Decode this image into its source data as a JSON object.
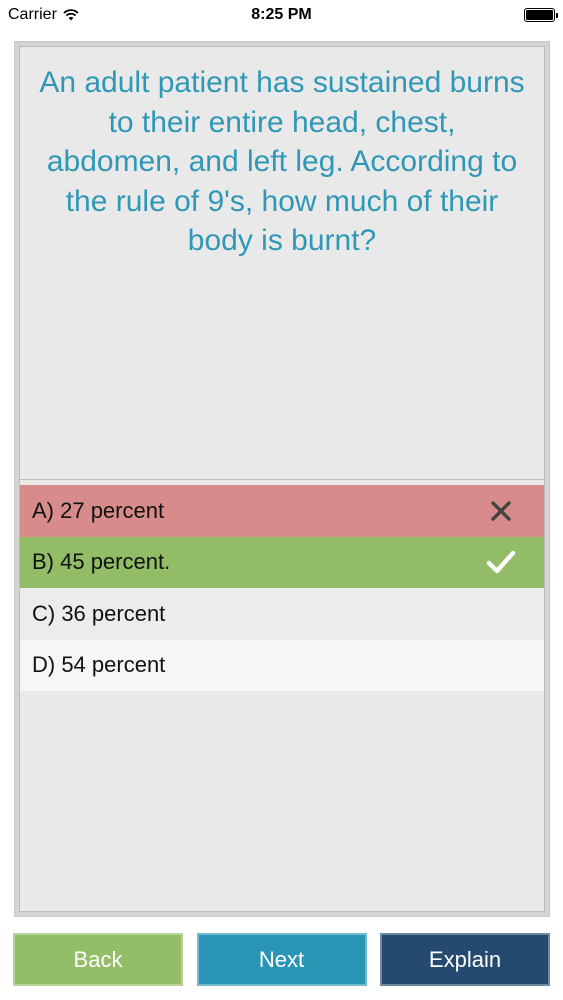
{
  "status_bar": {
    "carrier": "Carrier",
    "time": "8:25 PM"
  },
  "question": {
    "text": "An adult patient has sustained burns to their entire head, chest, abdomen, and left leg. According to the rule of 9's, how much of their body is burnt?"
  },
  "answers": [
    {
      "label": "A) 27 percent",
      "state": "wrong",
      "icon": "x-mark-icon"
    },
    {
      "label": "B) 45 percent.",
      "state": "correct",
      "icon": "check-mark-icon"
    },
    {
      "label": "C) 36 percent",
      "state": "neutral"
    },
    {
      "label": "D) 54 percent",
      "state": "neutral"
    }
  ],
  "buttons": {
    "back": "Back",
    "next": "Next",
    "explain": "Explain"
  },
  "colors": {
    "question_text": "#2f98b6",
    "wrong": "#d88b8b",
    "correct": "#92bd66",
    "back_button": "#93bd66",
    "next_button": "#2a96b5",
    "explain_button": "#244a70"
  }
}
